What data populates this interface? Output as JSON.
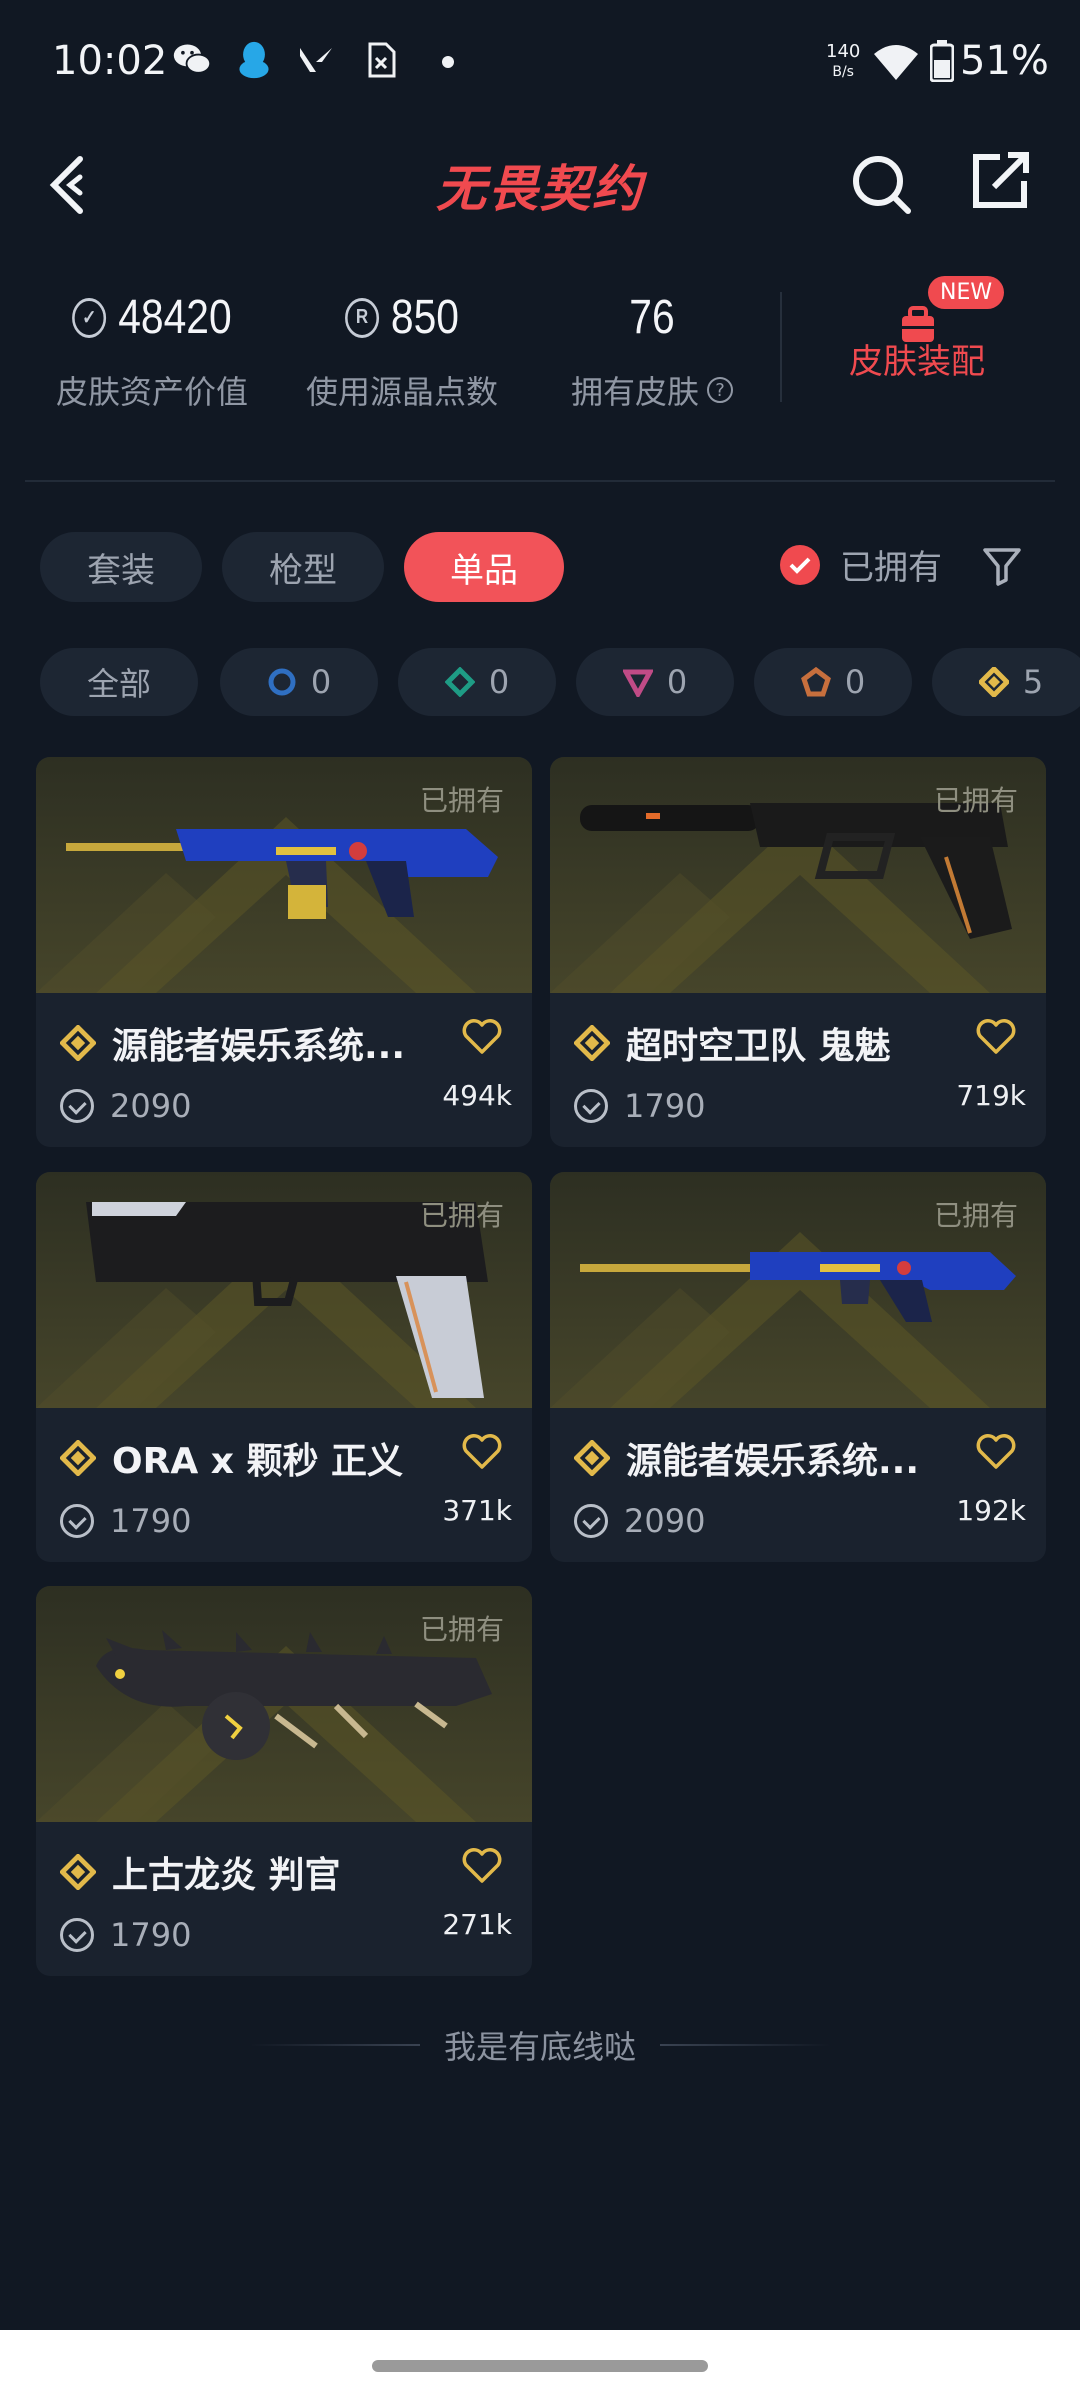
{
  "status_bar": {
    "time": "10:02",
    "net_speed_value": "140",
    "net_speed_unit": "B/s",
    "battery": "51%"
  },
  "header": {
    "title": "无畏契约",
    "brand_color": "#f04a4f"
  },
  "stats": {
    "asset_value": "48420",
    "asset_label": "皮肤资产价值",
    "points_value": "850",
    "points_label": "使用源晶点数",
    "skins_value": "76",
    "skins_label": "拥有皮肤",
    "equip_label": "皮肤装配",
    "equip_badge": "NEW"
  },
  "tabs": [
    {
      "label": "套装",
      "active": false
    },
    {
      "label": "枪型",
      "active": false
    },
    {
      "label": "单品",
      "active": true
    }
  ],
  "owned_filter": {
    "label": "已拥有",
    "checked": true
  },
  "chips": [
    {
      "label": "全部",
      "icon": "all"
    },
    {
      "count": "0",
      "icon": "blue-circle-icon",
      "color": "#2f6fc2"
    },
    {
      "count": "0",
      "icon": "teal-diamond-icon",
      "color": "#1e9c85"
    },
    {
      "count": "0",
      "icon": "pink-triangle-icon",
      "color": "#c04b86"
    },
    {
      "count": "0",
      "icon": "orange-pentagon-icon",
      "color": "#c76f3d"
    },
    {
      "count": "5",
      "icon": "gold-diamond-icon",
      "color": "#e2b94a"
    }
  ],
  "cards": [
    {
      "owned": "已拥有",
      "name": "源能者娱乐系统...",
      "price": "2090",
      "likes": "494k"
    },
    {
      "owned": "已拥有",
      "name": "超时空卫队 鬼魅",
      "price": "1790",
      "likes": "719k"
    },
    {
      "owned": "已拥有",
      "name": "ORA x 颗秒 正义",
      "price": "1790",
      "likes": "371k"
    },
    {
      "owned": "已拥有",
      "name": "源能者娱乐系统...",
      "price": "2090",
      "likes": "192k"
    },
    {
      "owned": "已拥有",
      "name": "上古龙炎 判官",
      "price": "1790",
      "likes": "271k"
    }
  ],
  "footer": {
    "text": "我是有底线哒"
  }
}
